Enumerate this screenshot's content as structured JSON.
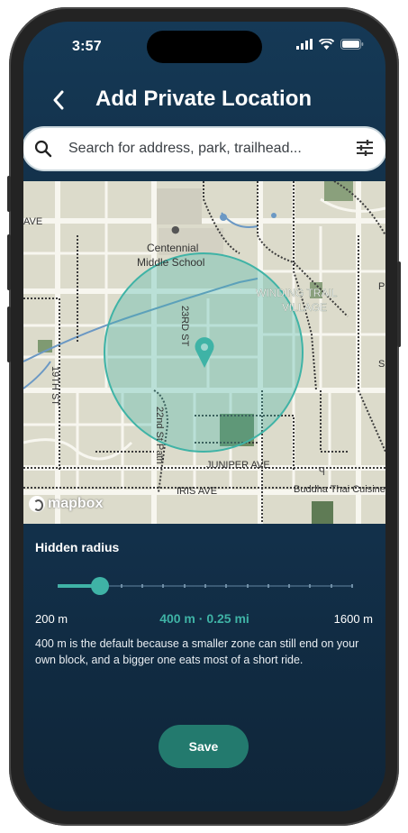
{
  "status_bar": {
    "time": "3:57"
  },
  "header": {
    "title": "Add Private Location",
    "back_icon": "chevron-left-icon"
  },
  "search": {
    "placeholder": "Search for address, park, trailhead...",
    "icon": "search-icon",
    "filter_icon": "sliders-icon"
  },
  "map": {
    "labels": {
      "ave_left": "AVE",
      "school_line1": "Centennial",
      "school_line2": "Middle School",
      "winding_line1": "WINDING TRAIL",
      "winding_line2": "VILLAGE",
      "street_23rd": "23RD ST",
      "street_19th": "19TH ST",
      "street_22nd_path": "22nd St Path",
      "juniper": "JUNIPER AVE",
      "iris": "IRIS AVE",
      "buddha": "Buddha Thai Cuisine",
      "p_edge": "P",
      "s_edge": "S"
    },
    "attribution": "mapbox",
    "accent_color": "#3fb3a6",
    "pin_icon": "location-pin-icon"
  },
  "radius": {
    "label": "Hidden radius",
    "min_label": "200 m",
    "max_label": "1600 m",
    "current_label": "400 m · 0.25 mi",
    "min": 200,
    "max": 1600,
    "value": 400,
    "description": "400 m is the default because a smaller zone can still end on your own block, and a bigger one eats most of a short ride."
  },
  "save_button": {
    "label": "Save"
  },
  "colors": {
    "accent": "#3fb3a6",
    "button": "#237a6e",
    "background": "#13314a"
  }
}
